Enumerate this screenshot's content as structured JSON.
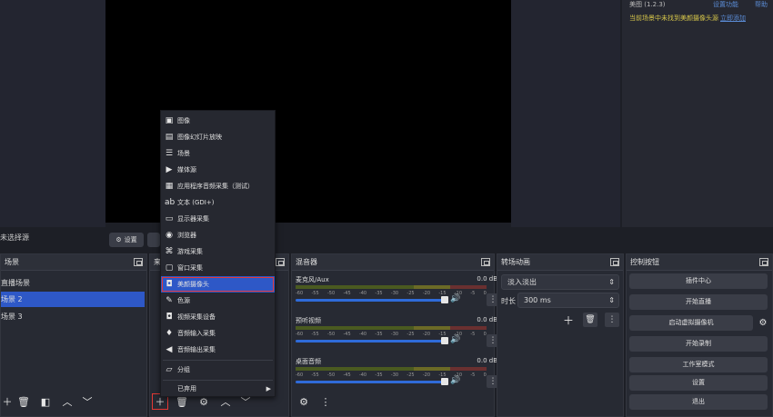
{
  "preview_right_panel": {
    "row_label": "美图 (1.2.3)",
    "link1": "设置功能",
    "link2": "帮助",
    "warning_text": "当前场景中未找到美颜摄像头源",
    "warning_link": "立即添加"
  },
  "source_toolbar": {
    "no_source_label": "未选择源",
    "settings_label": "设置"
  },
  "scenes_dock": {
    "title": "场景",
    "items": [
      "直播场景",
      "场景 2",
      "场景 3"
    ]
  },
  "sources_dock": {
    "title": "来源"
  },
  "mixer_dock": {
    "title": "混音器",
    "channels": [
      {
        "name": "麦克风/Aux",
        "db": "0.0 dB"
      },
      {
        "name": "预听视频",
        "db": "0.0 dB"
      },
      {
        "name": "桌面音频",
        "db": "0.0 dB"
      }
    ],
    "ticks": [
      "-60",
      "-55",
      "-50",
      "-45",
      "-40",
      "-35",
      "-30",
      "-25",
      "-20",
      "-15",
      "-10",
      "-5",
      "0"
    ]
  },
  "transitions_dock": {
    "title": "转场动画",
    "transition_value": "淡入淡出",
    "duration_label": "时长",
    "duration_value": "300 ms"
  },
  "controls_dock": {
    "title": "控制按钮",
    "buttons": [
      "插件中心",
      "开始直播",
      "启动虚拟摄像机",
      "开始录制",
      "工作室模式",
      "设置",
      "退出"
    ]
  },
  "add_source_menu": {
    "items": [
      {
        "label": "图像",
        "icon": "image-icon"
      },
      {
        "label": "图像幻灯片放映",
        "icon": "slideshow-icon"
      },
      {
        "label": "场景",
        "icon": "scene-list-icon"
      },
      {
        "label": "媒体源",
        "icon": "play-icon"
      },
      {
        "label": "应用程序音频采集（测试）",
        "icon": "app-audio-icon"
      },
      {
        "label": "文本 (GDI+)",
        "icon": "text-icon"
      },
      {
        "label": "显示器采集",
        "icon": "monitor-icon"
      },
      {
        "label": "浏览器",
        "icon": "globe-icon"
      },
      {
        "label": "游戏采集",
        "icon": "gamepad-icon"
      },
      {
        "label": "窗口采集",
        "icon": "window-icon"
      },
      {
        "label": "美颜摄像头",
        "icon": "camera-icon"
      },
      {
        "label": "色源",
        "icon": "brush-icon"
      },
      {
        "label": "视频采集设备",
        "icon": "camera-icon"
      },
      {
        "label": "音频输入采集",
        "icon": "mic-icon"
      },
      {
        "label": "音频输出采集",
        "icon": "speaker-icon"
      },
      {
        "label": "分组",
        "icon": "folder-icon"
      },
      {
        "label": "已弃用",
        "icon": "submenu-icon"
      }
    ]
  },
  "colors": {
    "accent": "#2e58c7",
    "highlight_box": "#e53935",
    "warning": "#d6c64a"
  }
}
